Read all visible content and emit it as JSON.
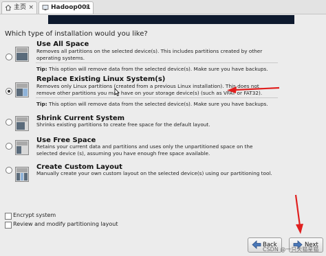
{
  "tabs": [
    {
      "label": "主页",
      "close": "×"
    },
    {
      "label": "Hadoop001",
      "close": "×"
    }
  ],
  "question": "Which type of installation would you like?",
  "options": [
    {
      "title": "Use All Space",
      "desc": "Removes all partitions on the selected device(s).  This includes partitions created by other operating systems.",
      "tip_label": "Tip:",
      "tip": " This option will remove data from the selected device(s).  Make sure you have backups.",
      "selected": false
    },
    {
      "title": "Replace Existing Linux System(s)",
      "desc": "Removes only Linux partitions (created from a previous Linux installation).  This does not remove other partitions you may have on your storage device(s) (such as VFAT or FAT32).",
      "tip_label": "Tip:",
      "tip": " This option will remove data from the selected device(s).  Make sure you have backups.",
      "selected": true
    },
    {
      "title": "Shrink Current System",
      "desc": "Shrinks existing partitions to create free space for the default layout.",
      "selected": false
    },
    {
      "title": "Use Free Space",
      "desc": "Retains your current data and partitions and uses only the unpartitioned space on the selected device (s), assuming you have enough free space available.",
      "selected": false
    },
    {
      "title": "Create Custom Layout",
      "desc": "Manually create your own custom layout on the selected device(s) using our partitioning tool.",
      "selected": false
    }
  ],
  "checkboxes": [
    {
      "label": "Encrypt system",
      "checked": false
    },
    {
      "label": "Review and modify partitioning layout",
      "checked": false
    }
  ],
  "buttons": {
    "back": "Back",
    "next": "Next"
  },
  "watermark": "CSDN @一只天猫星猫",
  "colors": {
    "banner": "#0e1a2e",
    "annotation_arrow": "#e0201f"
  }
}
